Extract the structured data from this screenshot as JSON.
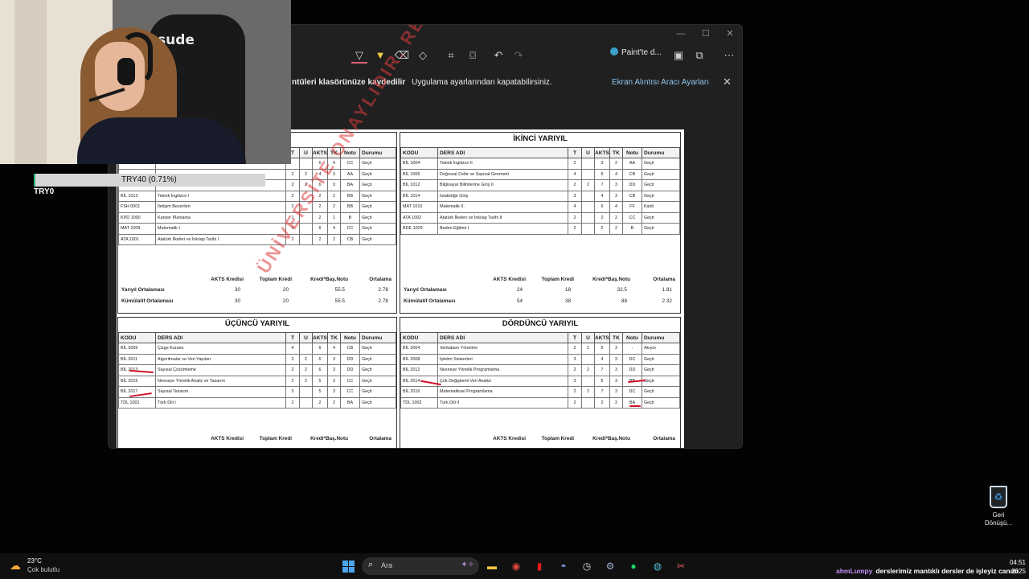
{
  "snip_tool": {
    "paint_label": "Paint'te d...",
    "notice_text_bold": "ntüleri klasörünüze kaydedilir",
    "notice_text": "Uygulama ayarlarından kapatabilirsiniz.",
    "settings_link": "Ekran Alıntısı Aracı Ayarları"
  },
  "transcript": {
    "watermark": "ÜNİVERSİTE ONAYLIDIR. RESMİ NİTELİK TAŞIMAZ",
    "headers": [
      "KODU",
      "DERS ADI",
      "T",
      "U",
      "AKTS",
      "TK",
      "Notu",
      "Durumu"
    ],
    "summary_headers": [
      "AKTS Kredisi",
      "Toplam Kredi",
      "Kredi*Baş.Notu",
      "Ortalama"
    ],
    "first": {
      "rows": [
        [
          "",
          "",
          "",
          "",
          "6",
          "4",
          "CC",
          "Geçti"
        ],
        [
          "",
          "",
          "2",
          "2",
          "4",
          "3",
          "AA",
          "Geçti"
        ],
        [
          "",
          "",
          "2",
          "2",
          "6",
          "3",
          "BA",
          "Geçti"
        ],
        [
          "BİL 1013",
          "Teknik İngilizce I",
          "2",
          "",
          "2",
          "2",
          "BB",
          "Geçti"
        ],
        [
          "FSH 0001",
          "İletişim Becerileri",
          "2",
          "",
          "2",
          "2",
          "BB",
          "Geçti"
        ],
        [
          "KPD 1000",
          "Kariyer Planlama",
          "1",
          "",
          "2",
          "1",
          "B",
          "Geçti"
        ],
        [
          "MAT 1009",
          "Matematik I.",
          "4",
          "",
          "6",
          "4",
          "CC",
          "Geçti"
        ],
        [
          "ATA 1001",
          "Atatürk İlkeleri ve İnkılap Tarihi I",
          "2",
          "",
          "2",
          "2",
          "CB",
          "Geçti"
        ]
      ],
      "summary": [
        [
          "Yarıyıl Ortalaması",
          "30",
          "20",
          "55.5",
          "2.78"
        ],
        [
          "Kümülatif Ortalaması",
          "30",
          "20",
          "55.5",
          "2.78"
        ]
      ]
    },
    "second": {
      "title": "İKİNCİ YARIYIL",
      "rows": [
        [
          "BİL 1004",
          "Teknik İngilizce II",
          "2",
          "",
          "3",
          "2",
          "AA",
          "Geçti"
        ],
        [
          "BİL 1006",
          "Doğrusal Cebir ve Sayısal Geometri",
          "4",
          "",
          "6",
          "4",
          "CB",
          "Geçti"
        ],
        [
          "BİL 1012",
          "Bilgisayar Bilimlerine Giriş II",
          "2",
          "2",
          "7",
          "3",
          "DD",
          "Geçti"
        ],
        [
          "BİL 1014",
          "İstatistiğe Giriş",
          "3",
          "",
          "4",
          "3",
          "CB",
          "Geçti"
        ],
        [
          "MAT 1010",
          "Matematik II.",
          "4",
          "",
          "6",
          "4",
          "FF",
          "Kaldı"
        ],
        [
          "ATA 1002",
          "Atatürk İlkeleri ve İnkılap Tarihi II",
          "2",
          "",
          "2",
          "2",
          "CC",
          "Geçti"
        ],
        [
          "BDE 1003",
          "Beden Eğitimi I",
          "2",
          "",
          "2",
          "2",
          "B",
          "Geçti"
        ]
      ],
      "summary": [
        [
          "Yarıyıl Ortalaması",
          "24",
          "18",
          "32.5",
          "1.81"
        ],
        [
          "Kümülatif Ortalaması",
          "54",
          "38",
          "88",
          "2.32"
        ]
      ]
    },
    "third": {
      "title": "ÜÇÜNCÜ YARIYIL",
      "rows": [
        [
          "BİL 2009",
          "Çizge Kuramı",
          "4",
          "",
          "6",
          "4",
          "CB",
          "Geçti"
        ],
        [
          "BİL 2011",
          "Algoritmalar ve Veri Yapıları",
          "2",
          "2",
          "6",
          "3",
          "DD",
          "Geçti"
        ],
        [
          "BİL 2013",
          "Sayısal Çözümleme",
          "2",
          "2",
          "6",
          "3",
          "DD",
          "Geçti"
        ],
        [
          "BİL 2015",
          "Nesneye Yönelik Analiz ve Tasarım",
          "2",
          "2",
          "5",
          "3",
          "CC",
          "Geçti"
        ],
        [
          "BİL 2017",
          "Sayısal Tasarım",
          "3",
          "",
          "5",
          "3",
          "CC",
          "Geçti"
        ],
        [
          "TDL 1001",
          "Türk Dili I",
          "2",
          "",
          "2",
          "2",
          "BA",
          "Geçti"
        ]
      ]
    },
    "fourth": {
      "title": "DÖRDÜNCÜ YARIYIL",
      "rows": [
        [
          "BİL 2004",
          "Veritabanı Yönetimi",
          "2",
          "2",
          "5",
          "3",
          "-",
          "Akıyor"
        ],
        [
          "BİL 2008",
          "İşletim Sistemleri",
          "3",
          "",
          "4",
          "3",
          "DC",
          "Geçti"
        ],
        [
          "BİL 2012",
          "Nesneye Yönelik Programlama",
          "2",
          "2",
          "7",
          "3",
          "DD",
          "Geçti"
        ],
        [
          "BİL 2014",
          "Çok Değişkenli Veri Analizi",
          "3",
          "",
          "5",
          "3",
          "BB",
          "Geçti"
        ],
        [
          "BİL 2016",
          "Matematiksel Programlama",
          "2",
          "2",
          "7",
          "3",
          "DC",
          "Geçti"
        ],
        [
          "TDL 1002",
          "Türk Dili II",
          "2",
          "",
          "2",
          "2",
          "BA",
          "Geçti"
        ]
      ]
    }
  },
  "stream": {
    "chair_text": "sude",
    "donation_goal": "TRY40 (0.71%)",
    "donation_fraction": 0.0071,
    "donation_total": "TRY0"
  },
  "desktop": {
    "recycle_label": "Geri Dönüşü..."
  },
  "taskbar": {
    "weather_temp": "23°C",
    "weather_desc": "Çok bulutlu",
    "search_placeholder": "Ara",
    "ticker_user": "ahmLumpy",
    "ticker_text": "derslerimiz mantıklı dersler de işleyiz canım",
    "clock_time": "04:51",
    "clock_date": "2025"
  },
  "colors": {
    "accent_pen": "#d0142a",
    "donation_green": "#2bb673",
    "link_blue": "#8fc8f0"
  }
}
